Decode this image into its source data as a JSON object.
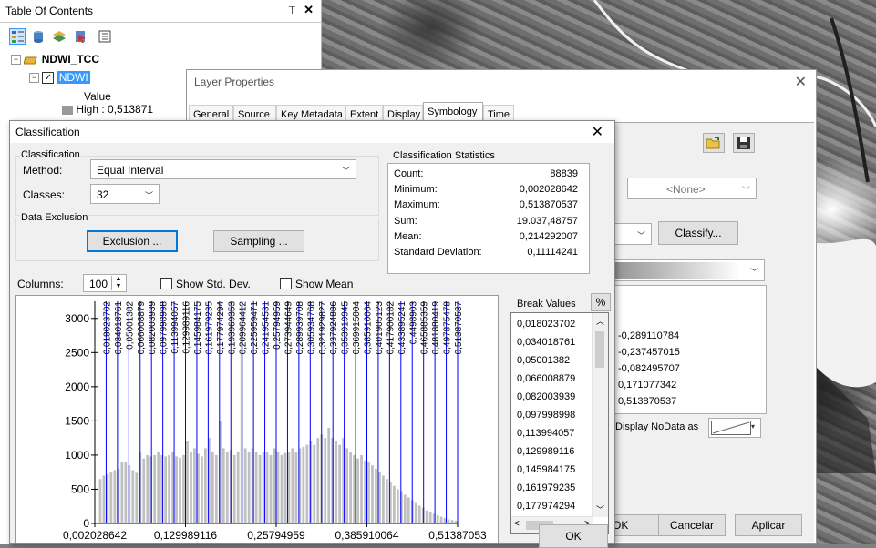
{
  "toc": {
    "title": "Table Of Contents",
    "pin": "⍑",
    "close": "✕",
    "group_name": "NDWI_TCC",
    "layer_name": "NDWI",
    "legend_heading": "Value",
    "legend_high": "High : 0,513871"
  },
  "layer_properties": {
    "title": "Layer Properties",
    "close": "✕",
    "tabs": [
      "General",
      "Source",
      "Key Metadata",
      "Extent",
      "Display",
      "Symbology",
      "Time"
    ],
    "active_tab": "Symbology",
    "normalization_value": "<None>",
    "classify_button": "Classify...",
    "labels": [
      "-0,289110784",
      "-0,237457015",
      "-0,082495707",
      "0,171077342",
      "0,513870537"
    ],
    "display_nodata_label": "Display NoData as",
    "ok_button": "OK",
    "cancel_button": "Cancelar",
    "apply_button": "Aplicar"
  },
  "classification": {
    "title": "Classification",
    "close": "✕",
    "group_classification": "Classification",
    "method_label": "Method:",
    "method_value": "Equal Interval",
    "classes_label": "Classes:",
    "classes_value": "32",
    "group_exclusion": "Data Exclusion",
    "exclusion_button": "Exclusion ...",
    "sampling_button": "Sampling ...",
    "stats_title": "Classification Statistics",
    "stats": [
      {
        "label": "Count:",
        "value": "88839"
      },
      {
        "label": "Minimum:",
        "value": "0,002028642"
      },
      {
        "label": "Maximum:",
        "value": "0,513870537"
      },
      {
        "label": "Sum:",
        "value": "19.037,48757"
      },
      {
        "label": "Mean:",
        "value": "0,214292007"
      },
      {
        "label": "Standard Deviation:",
        "value": "0,11114241"
      }
    ],
    "columns_label": "Columns:",
    "columns_value": "100",
    "show_std_dev": "Show Std. Dev.",
    "show_mean": "Show Mean",
    "break_values_label": "Break Values",
    "percent_button": "%",
    "break_values_visible": [
      "0,018023702",
      "0,034018761",
      "0,05001382",
      "0,066008879",
      "0,082003939",
      "0,097998998",
      "0,113994057",
      "0,129989116",
      "0,145984175",
      "0,161979235",
      "0,177974294"
    ],
    "ok_button": "OK"
  },
  "chart_data": {
    "type": "bar",
    "title": "",
    "xlabel": "",
    "ylabel": "",
    "xlim": [
      0.002028642,
      0.513870537
    ],
    "ylim": [
      0,
      3250
    ],
    "y_ticks": [
      0,
      500,
      1000,
      1500,
      2000,
      2500,
      3000
    ],
    "x_tick_labels": [
      "0,002028642",
      "0,129989116",
      "0,25794959",
      "0,385910064",
      "0,51387053"
    ],
    "x_tick_values": [
      0.002028642,
      0.129989116,
      0.25794959,
      0.385910064,
      0.51387053
    ],
    "bar_color": "#c0c0c0",
    "break_line_color": "#0000ff",
    "histogram_counts": [
      0,
      650,
      700,
      720,
      750,
      780,
      800,
      900,
      900,
      850,
      780,
      740,
      1050,
      950,
      1000,
      980,
      1000,
      1050,
      1000,
      980,
      1000,
      1050,
      980,
      960,
      1000,
      1200,
      1050,
      1100,
      1020,
      980,
      1100,
      1250,
      1050,
      1000,
      1500,
      1100,
      1050,
      1080,
      1000,
      1050,
      3200,
      1100,
      1050,
      1100,
      1050,
      1000,
      1050,
      1050,
      1000,
      1100,
      1050,
      1000,
      1030,
      1050,
      1100,
      1050,
      1100,
      1120,
      1150,
      1200,
      1150,
      1250,
      1300,
      1250,
      1400,
      1250,
      1200,
      1150,
      1250,
      1100,
      1050,
      1000,
      950,
      1000,
      920,
      900,
      850,
      800,
      750,
      700,
      650,
      600,
      550,
      500,
      470,
      420,
      380,
      340,
      300,
      260,
      230,
      190,
      170,
      140,
      120,
      100,
      80,
      60,
      50,
      40
    ],
    "break_values": [
      0.018023702,
      0.034018761,
      0.05001382,
      0.066008879,
      0.082003939,
      0.097998998,
      0.113994057,
      0.129989116,
      0.145984175,
      0.161979235,
      0.177974294,
      0.193969353,
      0.209964412,
      0.225959471,
      0.241954531,
      0.25794959,
      0.273944649,
      0.289939708,
      0.305934768,
      0.321929827,
      0.337924886,
      0.353919945,
      0.369915004,
      0.385910064,
      0.401905123,
      0.417900182,
      0.433895241,
      0.4498903,
      0.465885359,
      0.481880419,
      0.497875478,
      0.513870537
    ],
    "break_labels": [
      "0,018023702",
      "0,034018761",
      "0,05001382",
      "0,066008879",
      "0,082003939",
      "0,097998998",
      "0,113994057",
      "0,129989116",
      "0,145984175",
      "0,161979235",
      "0,177974294",
      "0,193969353",
      "0,209964412",
      "0,225959471",
      "0,241954531",
      "0,25794959",
      "0,273944649",
      "0,289939708",
      "0,305934768",
      "0,321929827",
      "0,337924886",
      "0,353919945",
      "0,369915004",
      "0,385910064",
      "0,401905123",
      "0,417900182",
      "0,433895241",
      "0,4498903",
      "0,465885359",
      "0,481880419",
      "0,497875478",
      "0,513870537"
    ]
  }
}
